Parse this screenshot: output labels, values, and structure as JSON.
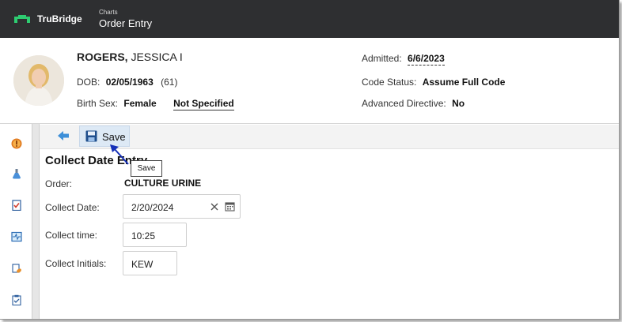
{
  "header": {
    "brand": "TruBridge",
    "breadcrumb": "Charts",
    "title": "Order Entry",
    "brand_color": "#2e2f31",
    "logo_color": "#2ecc71"
  },
  "patient": {
    "last_name": "ROGERS,",
    "first_name": " JESSICA I",
    "dob_label": "DOB:",
    "dob_value": "02/05/1963",
    "age": "(61)",
    "birth_sex_label": "Birth Sex:",
    "birth_sex_value": "Female",
    "gender_identity": "Not Specified",
    "admitted_label": "Admitted:",
    "admitted_value": "6/6/2023",
    "code_status_label": "Code Status:",
    "code_status_value": "Assume Full Code",
    "advanced_directive_label": "Advanced Directive:",
    "advanced_directive_value": "No"
  },
  "left_rail": {
    "icons": [
      "alert-icon",
      "lab-flask-icon",
      "checklist-icon",
      "vitals-monitor-icon",
      "medication-icon",
      "clipboard-icon"
    ]
  },
  "toolbar": {
    "save_label": "Save",
    "tooltip": "Save"
  },
  "form": {
    "section_title": "Collect Date Entry",
    "order_label": "Order:",
    "order_value": "CULTURE URINE",
    "collect_date_label": "Collect Date:",
    "collect_date_value": "2/20/2024",
    "collect_time_label": "Collect time:",
    "collect_time_value": "10:25",
    "collect_initials_label": "Collect Initials:",
    "collect_initials_value": "KEW"
  }
}
